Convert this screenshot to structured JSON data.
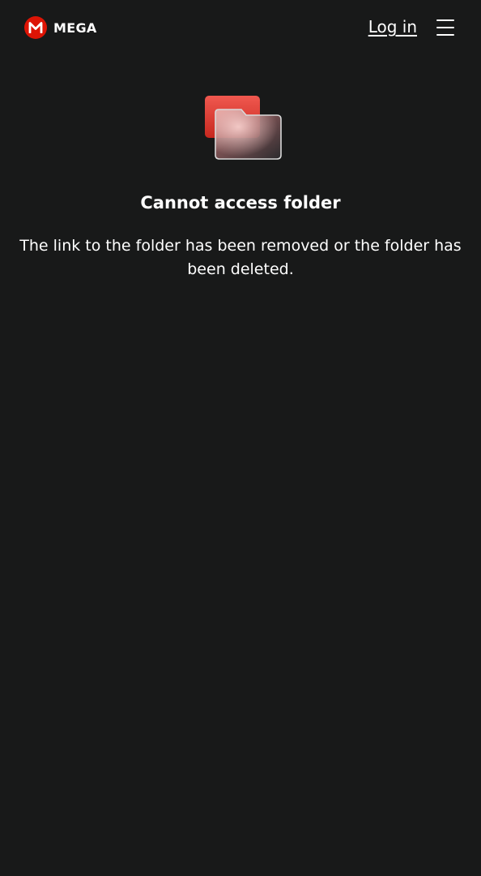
{
  "header": {
    "brand_name": "MEGA",
    "brand_badge_letter": "M",
    "login_label": "Log in"
  },
  "error": {
    "title": "Cannot access folder",
    "message": "The link to the folder has been removed or the folder has been deleted."
  },
  "colors": {
    "background": "#181919",
    "brand_red": "#dd1405",
    "text": "#ffffff"
  },
  "icons": {
    "menu": "hamburger-menu-icon",
    "illustration": "broken-folder-icon"
  }
}
